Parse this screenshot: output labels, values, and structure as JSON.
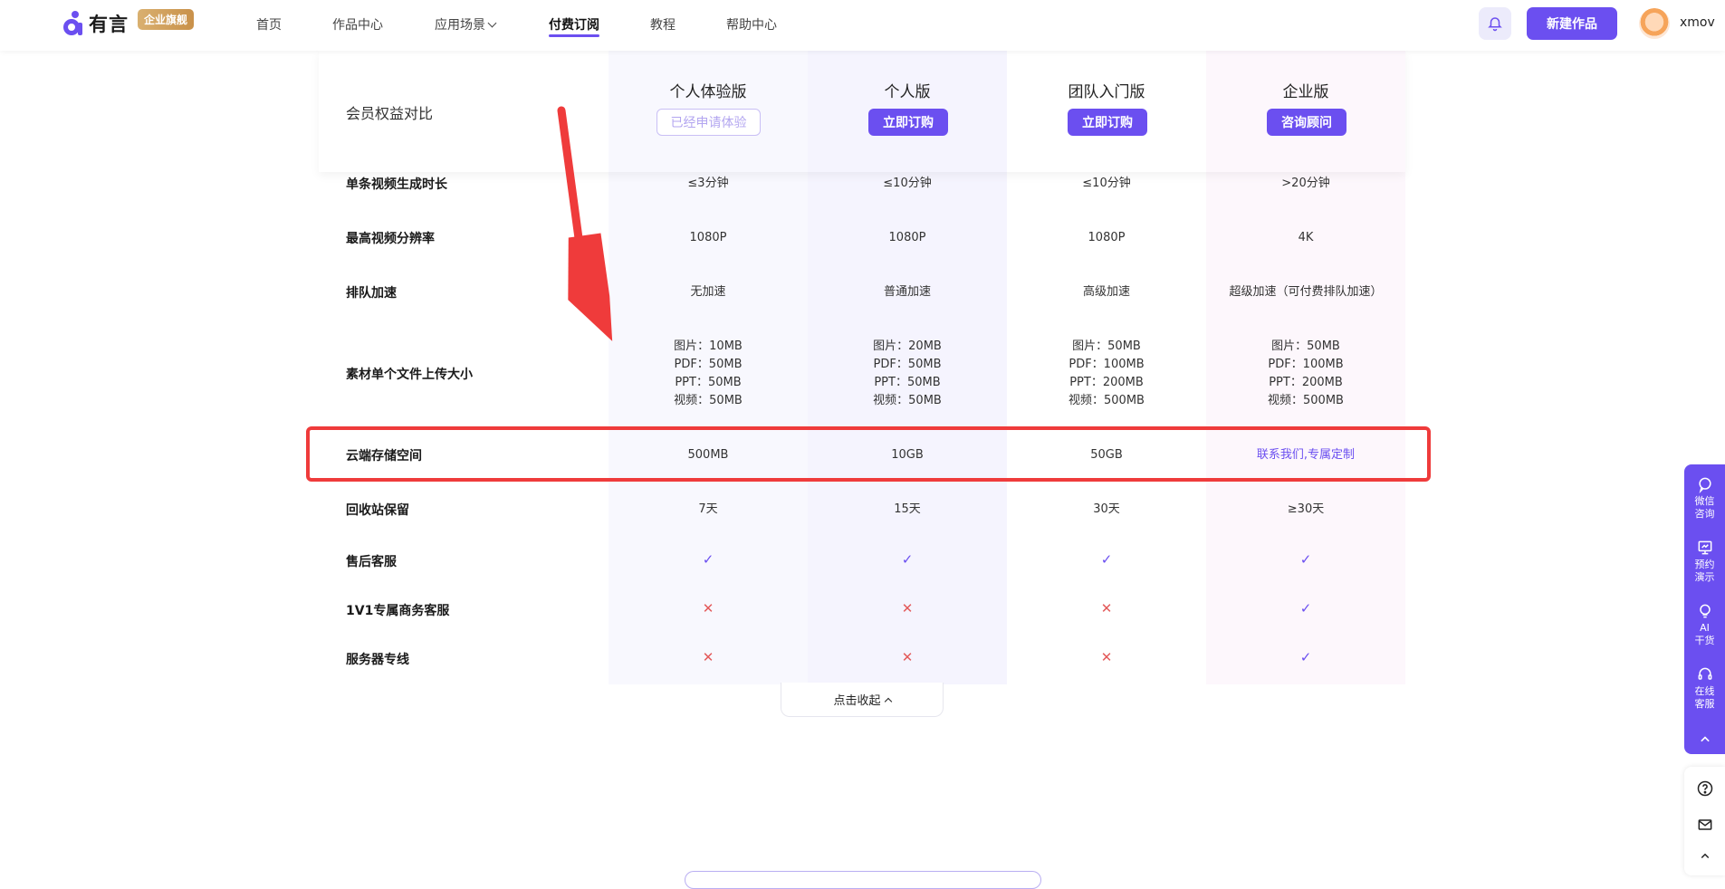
{
  "nav": {
    "logo_text": "有言",
    "logo_badge": "企业旗舰",
    "items": [
      "首页",
      "作品中心",
      "应用场景",
      "付费订阅",
      "教程",
      "帮助中心"
    ],
    "new_button": "新建作品",
    "username": "xmov"
  },
  "compare": {
    "label": "会员权益对比",
    "plans": [
      {
        "name": "个人体验版",
        "button": "已经申请体验"
      },
      {
        "name": "个人版",
        "button": "立即订购"
      },
      {
        "name": "团队入门版",
        "button": "立即订购"
      },
      {
        "name": "企业版",
        "button": "咨询顾问"
      }
    ]
  },
  "rows": [
    {
      "label": "单条视频生成时长",
      "values": [
        "≤3分钟",
        "≤10分钟",
        "≤10分钟",
        ">20分钟"
      ]
    },
    {
      "label": "最高视频分辨率",
      "values": [
        "1080P",
        "1080P",
        "1080P",
        "4K"
      ]
    },
    {
      "label": "排队加速",
      "values": [
        "无加速",
        "普通加速",
        "高级加速",
        "超级加速（可付费排队加速）"
      ]
    },
    {
      "label": "素材单个文件上传大小",
      "values": [
        [
          "图片：10MB",
          "PDF：50MB",
          "PPT：50MB",
          "视频：50MB"
        ],
        [
          "图片：20MB",
          "PDF：50MB",
          "PPT：50MB",
          "视频：50MB"
        ],
        [
          "图片：50MB",
          "PDF：100MB",
          "PPT：200MB",
          "视频：500MB"
        ],
        [
          "图片：50MB",
          "PDF：100MB",
          "PPT：200MB",
          "视频：500MB"
        ]
      ]
    },
    {
      "label": "云端存储空间",
      "values": [
        "500MB",
        "10GB",
        "50GB",
        "联系我们,专属定制"
      ]
    },
    {
      "label": "回收站保留",
      "values": [
        "7天",
        "15天",
        "30天",
        "≥30天"
      ]
    },
    {
      "label": "售后客服",
      "values": [
        "✓",
        "✓",
        "✓",
        "✓"
      ]
    },
    {
      "label": "1V1专属商务客服",
      "values": [
        "✕",
        "✕",
        "✕",
        "✓"
      ]
    },
    {
      "label": "服务器专线",
      "values": [
        "✕",
        "✕",
        "✕",
        "✓"
      ]
    }
  ],
  "collapse_label": "点击收起",
  "side": {
    "items": [
      [
        "微信",
        "咨询"
      ],
      [
        "预约",
        "演示"
      ],
      [
        "AI",
        "干货"
      ],
      [
        "在线",
        "客服"
      ]
    ],
    "help": "?"
  },
  "colors": {
    "accent": "#6b4ff0",
    "annotation": "#ef3b3b",
    "cross": "#e35a5a"
  }
}
